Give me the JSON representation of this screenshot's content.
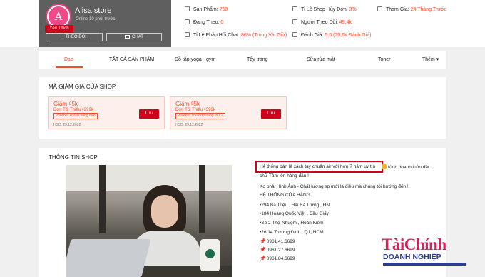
{
  "shop": {
    "name": "Alisa.store",
    "online": "Online 10 phút trước",
    "favorite_badge": "Yêu Thích",
    "follow_button": "+ THEO DÕI",
    "chat_button": "CHAT",
    "avatar_letter": "A"
  },
  "stats": {
    "products_label": "Sản Phẩm:",
    "products_value": "750",
    "following_label": "Đang Theo:",
    "following_value": "0",
    "chat_rate_label": "Tỉ Lệ Phản Hồi Chat:",
    "chat_rate_value": "86% (Trong Vài Giờ)",
    "cancel_rate_label": "Tỉ Lệ Shop Hủy Đơn:",
    "cancel_rate_value": "3%",
    "followers_label": "Người Theo Dõi:",
    "followers_value": "49,4k",
    "rating_label": "Đánh Giá:",
    "rating_value": "5.0 (20,6k Đánh Giá)",
    "joined_label": "Tham Gia:",
    "joined_value": "24 Tháng Trước"
  },
  "nav": {
    "items": [
      "Dạo",
      "TẤT CẢ SẢN PHẨM",
      "Đồ tập yoga - gym",
      "Tẩy trang",
      "Sữa rửa mặt",
      "Toner",
      "Thêm ▾"
    ],
    "active_index": 0
  },
  "vouchers": {
    "title": "MÃ GIẢM GIÁ CỦA SHOP",
    "items": [
      {
        "discount": "Giảm ₫5k",
        "min": "Đơn Tối Thiểu ₫299k",
        "tag": "Voucher khách hàng mới",
        "expiry": "HSD: 29.12.2022",
        "button": "Lưu"
      },
      {
        "discount": "Giảm ₫5k",
        "min": "Đơn Tối Thiểu ₫399k",
        "tag": "Voucher cho đơn hàng thứ 2",
        "expiry": "HSD: 29.12.2022",
        "button": "Lưu"
      }
    ]
  },
  "info": {
    "title": "THÔNG TIN SHOP",
    "lines": [
      "Hệ thống bán lẻ xách tay chuẩn air với hơn 7 năm uy tín",
      "Kinh doanh luôn đặt",
      "chữ Tâm lên hàng đầu !",
      "Ko phải Hình Ảnh - Chất lượng sp mới là điều mà chúng tôi hướng đến !",
      "HỆ THỐNG CỬA HÀNG :",
      "•294 Bà Triệu , Hai Bà Trưng , HN",
      "•184 Hoàng Quốc Việt , Cầu Giấy",
      "•Số 2 Thợ Nhuộm , Hoàn Kiếm",
      "•26/14 Trương Định , Q1, HCM",
      "0961.41.6699",
      "0961.27.6699",
      "0961.84.6699"
    ]
  },
  "watermark": {
    "line1": "TàiChính",
    "line2": "DOANH NGHIỆP"
  },
  "colors": {
    "accent": "#ee4d2d",
    "button_red": "#d0011b",
    "shop_card": "#5f5f5f"
  }
}
